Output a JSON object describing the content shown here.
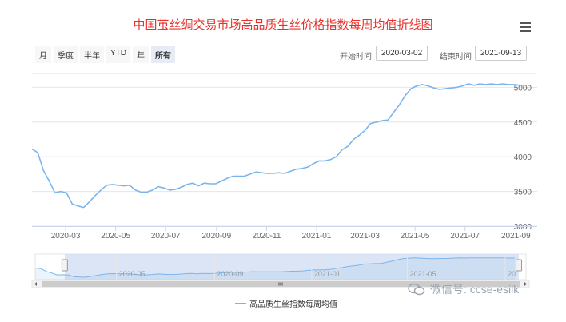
{
  "title": "中国茧丝绸交易市场高品质生丝价格指数每周均值折线图",
  "range_buttons": [
    "月",
    "季度",
    "半年",
    "YTD",
    "年",
    "所有"
  ],
  "start_label": "开始时间",
  "start_date": "2020-03-02",
  "end_label": "结束时间",
  "end_date": "2021-09-13",
  "legend_label": "高品质生丝指数每周均值",
  "watermark": "微信号: ccse-esilk",
  "colors": {
    "title": "#e8302a",
    "series": "#7cb5ec",
    "navigator_mask": "#c5d3ef"
  },
  "chart_data": {
    "type": "line",
    "title": "中国茧丝绸交易市场高品质生丝价格指数每周均值折线图",
    "xlabel": "",
    "ylabel": "",
    "x_start": "2020-01-20",
    "x_end": "2021-09-27",
    "ylim": [
      3000,
      5200
    ],
    "yticks": [
      3000,
      3500,
      4000,
      4500,
      5000
    ],
    "xticks": [
      "2020-03",
      "2020-05",
      "2020-07",
      "2020-09",
      "2020-11",
      "2021-01",
      "2021-03",
      "2021-05",
      "2021-07",
      "2021-09"
    ],
    "grid": true,
    "legend_position": "bottom-center",
    "series": [
      {
        "name": "高品质生丝指数每周均值",
        "points": [
          [
            "2020-01-20",
            4110
          ],
          [
            "2020-01-27",
            4060
          ],
          [
            "2020-02-03",
            3800
          ],
          [
            "2020-02-10",
            3650
          ],
          [
            "2020-02-17",
            3480
          ],
          [
            "2020-02-24",
            3500
          ],
          [
            "2020-03-02",
            3480
          ],
          [
            "2020-03-09",
            3320
          ],
          [
            "2020-03-16",
            3290
          ],
          [
            "2020-03-23",
            3270
          ],
          [
            "2020-03-30",
            3350
          ],
          [
            "2020-04-06",
            3440
          ],
          [
            "2020-04-13",
            3520
          ],
          [
            "2020-04-20",
            3590
          ],
          [
            "2020-04-27",
            3600
          ],
          [
            "2020-05-04",
            3590
          ],
          [
            "2020-05-11",
            3580
          ],
          [
            "2020-05-18",
            3590
          ],
          [
            "2020-05-25",
            3520
          ],
          [
            "2020-06-01",
            3490
          ],
          [
            "2020-06-08",
            3490
          ],
          [
            "2020-06-15",
            3520
          ],
          [
            "2020-06-22",
            3570
          ],
          [
            "2020-06-29",
            3550
          ],
          [
            "2020-07-06",
            3520
          ],
          [
            "2020-07-13",
            3530
          ],
          [
            "2020-07-20",
            3560
          ],
          [
            "2020-07-27",
            3600
          ],
          [
            "2020-08-03",
            3620
          ],
          [
            "2020-08-10",
            3580
          ],
          [
            "2020-08-17",
            3620
          ],
          [
            "2020-08-24",
            3610
          ],
          [
            "2020-08-31",
            3610
          ],
          [
            "2020-09-07",
            3650
          ],
          [
            "2020-09-14",
            3690
          ],
          [
            "2020-09-21",
            3720
          ],
          [
            "2020-09-28",
            3720
          ],
          [
            "2020-10-05",
            3720
          ],
          [
            "2020-10-12",
            3750
          ],
          [
            "2020-10-19",
            3780
          ],
          [
            "2020-10-26",
            3770
          ],
          [
            "2020-11-02",
            3760
          ],
          [
            "2020-11-09",
            3760
          ],
          [
            "2020-11-16",
            3770
          ],
          [
            "2020-11-23",
            3760
          ],
          [
            "2020-11-30",
            3790
          ],
          [
            "2020-12-07",
            3820
          ],
          [
            "2020-12-14",
            3830
          ],
          [
            "2020-12-21",
            3850
          ],
          [
            "2020-12-28",
            3900
          ],
          [
            "2021-01-04",
            3940
          ],
          [
            "2021-01-11",
            3940
          ],
          [
            "2021-01-18",
            3960
          ],
          [
            "2021-01-25",
            4000
          ],
          [
            "2021-02-01",
            4100
          ],
          [
            "2021-02-08",
            4150
          ],
          [
            "2021-02-15",
            4250
          ],
          [
            "2021-02-22",
            4310
          ],
          [
            "2021-03-01",
            4380
          ],
          [
            "2021-03-08",
            4480
          ],
          [
            "2021-03-15",
            4500
          ],
          [
            "2021-03-22",
            4520
          ],
          [
            "2021-03-29",
            4530
          ],
          [
            "2021-04-05",
            4640
          ],
          [
            "2021-04-12",
            4750
          ],
          [
            "2021-04-19",
            4880
          ],
          [
            "2021-04-26",
            4980
          ],
          [
            "2021-05-03",
            5020
          ],
          [
            "2021-05-10",
            5040
          ],
          [
            "2021-05-17",
            5020
          ],
          [
            "2021-05-24",
            4990
          ],
          [
            "2021-05-31",
            4970
          ],
          [
            "2021-06-07",
            4980
          ],
          [
            "2021-06-14",
            4990
          ],
          [
            "2021-06-21",
            5000
          ],
          [
            "2021-06-28",
            5020
          ],
          [
            "2021-07-05",
            5050
          ],
          [
            "2021-07-12",
            5030
          ],
          [
            "2021-07-19",
            5050
          ],
          [
            "2021-07-26",
            5040
          ],
          [
            "2021-08-02",
            5050
          ],
          [
            "2021-08-09",
            5040
          ],
          [
            "2021-08-16",
            5050
          ],
          [
            "2021-08-23",
            5040
          ],
          [
            "2021-08-30",
            5040
          ],
          [
            "2021-09-06",
            5030
          ],
          [
            "2021-09-13",
            5030
          ]
        ]
      }
    ],
    "navigator": {
      "labels": [
        "2020-05",
        "2020-09",
        "2021-01",
        "2021-05",
        "20"
      ],
      "selected_start": "2020-03-02",
      "selected_end": "2021-09-13"
    }
  }
}
